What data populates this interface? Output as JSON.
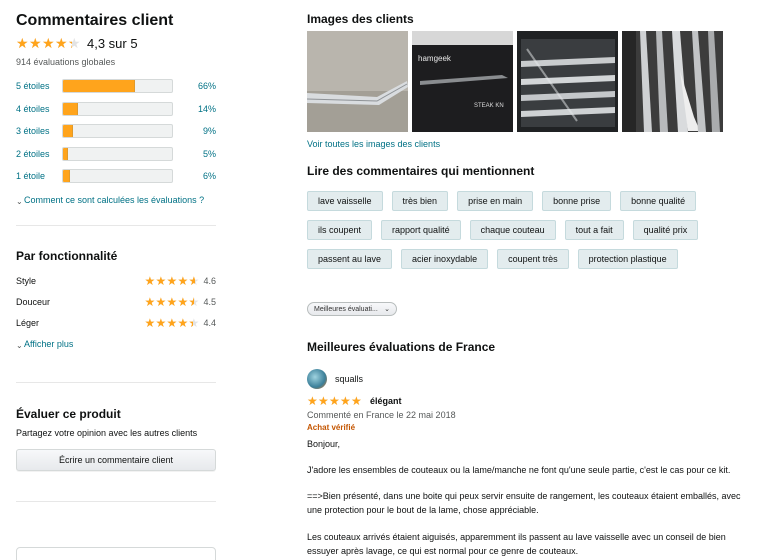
{
  "summary": {
    "title": "Commentaires client",
    "rating": 4.3,
    "rating_text": "4,3 sur 5",
    "global_count": "914 évaluations globales",
    "histogram": [
      {
        "label": "5 étoiles",
        "pct": 66,
        "pct_text": "66%"
      },
      {
        "label": "4 étoiles",
        "pct": 14,
        "pct_text": "14%"
      },
      {
        "label": "3 étoiles",
        "pct": 9,
        "pct_text": "9%"
      },
      {
        "label": "2 étoiles",
        "pct": 5,
        "pct_text": "5%"
      },
      {
        "label": "1 étoile",
        "pct": 6,
        "pct_text": "6%"
      }
    ],
    "how_calculated": "Comment ce sont calculées les évaluations ?"
  },
  "features": {
    "title": "Par fonctionnalité",
    "items": [
      {
        "name": "Style",
        "rating": 4.6,
        "value": "4.6"
      },
      {
        "name": "Douceur",
        "rating": 4.5,
        "value": "4.5"
      },
      {
        "name": "Léger",
        "rating": 4.4,
        "value": "4.4"
      }
    ],
    "show_more": "Afficher plus"
  },
  "evaluate": {
    "title": "Évaluer ce produit",
    "subtitle": "Partagez votre opinion avec les autres clients",
    "button": "Écrire un commentaire client"
  },
  "images": {
    "title": "Images des clients",
    "thumb_brand": "hamgeek",
    "thumb_caption": "STEAK KN",
    "see_all": "Voir toutes les images des clients"
  },
  "mentions": {
    "title": "Lire des commentaires qui mentionnent",
    "chips": [
      [
        "lave vaisselle",
        "très bien",
        "prise en main",
        "bonne prise",
        "bonne qualité"
      ],
      [
        "ils coupent",
        "rapport qualité",
        "chaque couteau",
        "tout a fait",
        "qualité prix"
      ],
      [
        "passent au lave",
        "acier inoxydable",
        "coupent très",
        "protection plastique"
      ]
    ]
  },
  "sort": {
    "label": "Meilleures évaluati..."
  },
  "top_reviews": {
    "title": "Meilleures évaluations de France",
    "review": {
      "author": "squalls",
      "rating": 5,
      "title": "élégant",
      "date": "Commenté en France le 22 mai 2018",
      "verified": "Achat vérifié",
      "paragraphs": [
        "Bonjour,",
        "J'adore les ensembles de couteaux ou la lame/manche ne font qu'une seule partie, c'est le cas pour ce kit.",
        "==>Bien présenté, dans une boite qui peux servir ensuite de rangement, les couteaux étaient emballés, avec une protection pour le bout de la lame, chose appréciable.",
        "Les couteaux arrivés étaient aiguisés, apparemment ils passent au lave vaisselle avec un conseil de bien essuyer après lavage, ce qui est normal pour ce genre de couteaux."
      ]
    }
  },
  "colors": {
    "star": "#ffa41c",
    "link": "#007185",
    "verified": "#c45500",
    "chip_bg": "#e3ecee"
  }
}
